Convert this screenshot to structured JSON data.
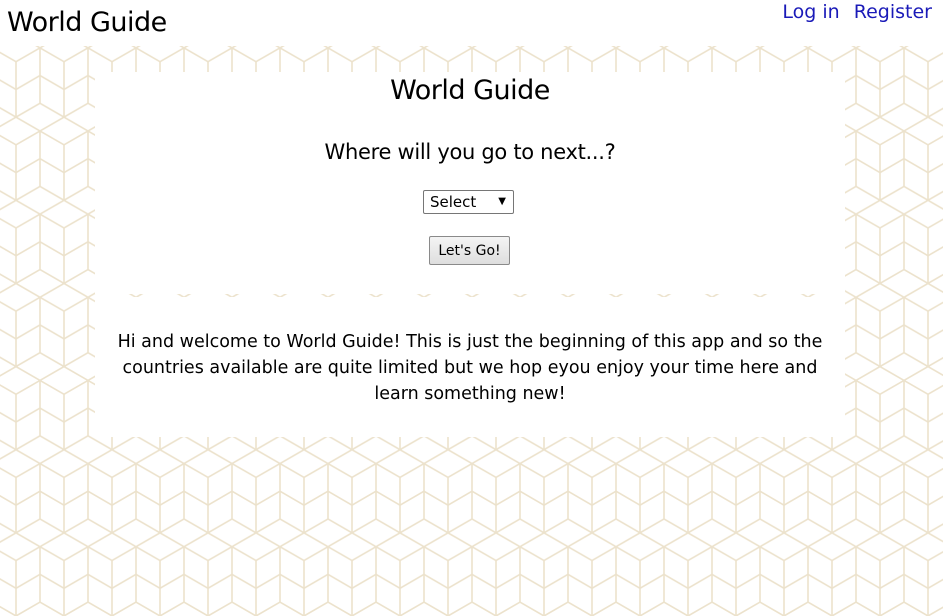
{
  "header": {
    "site_title": "World Guide",
    "login_label": "Log in",
    "register_label": "Register"
  },
  "main": {
    "title": "World Guide",
    "subtitle": "Where will you go to next...?",
    "destination_select": {
      "selected": "Select"
    },
    "go_button_label": "Let's Go!"
  },
  "welcome": {
    "text": "Hi and welcome to World Guide! This is just the beginning of this app and so the countries available are quite limited but we hop eyou enjoy your time here and learn something new!"
  },
  "colors": {
    "link": "#1a1ab8",
    "pattern_line": "#ece2cc",
    "background": "#ffffff"
  }
}
